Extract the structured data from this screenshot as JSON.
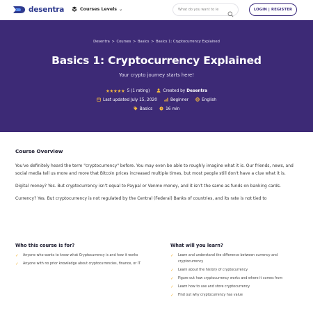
{
  "header": {
    "logo_text": "desentra",
    "courses_levels_label": "Courses Levels",
    "search_placeholder": "What do you want to le",
    "login_label": "LOGIN | REGISTER"
  },
  "breadcrumb": [
    "Desentra",
    "Courses",
    "Basics",
    "Basics 1: Cryptocurrency Explained"
  ],
  "breadcrumb_separator": ">",
  "hero": {
    "title": "Basics 1: Cryptocurrency Explained",
    "subtitle": "Your crypto journey starts here!",
    "rating_stars": "★★★★★",
    "rating_text": "5 (1 rating)",
    "created_by_label": "Created by",
    "author": "Desentra",
    "updated": "Last updated July 15, 2020",
    "level": "Beginner",
    "language": "English",
    "tag": "Basics",
    "duration": "16 min"
  },
  "overview": {
    "title": "Course Overview",
    "paragraphs": [
      "You've definitely heard the term \"cryptocurrency\" before. You may even be able to roughly imagine what it is. Our friends, news, and social media tell us more and more that Bitcoin prices increased multiple times, but most people still don't have a clue what it is.",
      "Digital money? Yes. But cryptocurrency isn't equal to Paypal or Venmo money, and it isn't the same as funds on banking cards.",
      "Currency? Yes. But cryptocurrency is not regulated by the Central (Federal) Banks of countries, and its rate is not tied to"
    ]
  },
  "who_for": {
    "title": "Who this course is for?",
    "items": [
      "Anyone who wants to know what Cryptocurrency is and how it works",
      "Anyone with no prior knowledge about cryptocurrencies, finance, or IT"
    ]
  },
  "will_learn": {
    "title": "What will you learn?",
    "items": [
      "Learn and understand the difference between currency and cryptocurrency",
      "Learn about the history of cryptocurrency",
      "Figure out how cryptocurrency works and where it comes from",
      "Learn how to use and store cryptocurrency",
      "Find out why cryptocurrency has value"
    ]
  },
  "colors": {
    "brand": "#2f3b8f",
    "hero_bg": "#3d2a76",
    "accent": "#f5b940"
  },
  "icons": [
    "logo-icon",
    "stack-icon",
    "chevron-down-icon",
    "search-icon",
    "star-icon",
    "user-icon",
    "calendar-icon",
    "level-bars-icon",
    "globe-icon",
    "tag-icon",
    "clock-icon",
    "check-icon"
  ]
}
